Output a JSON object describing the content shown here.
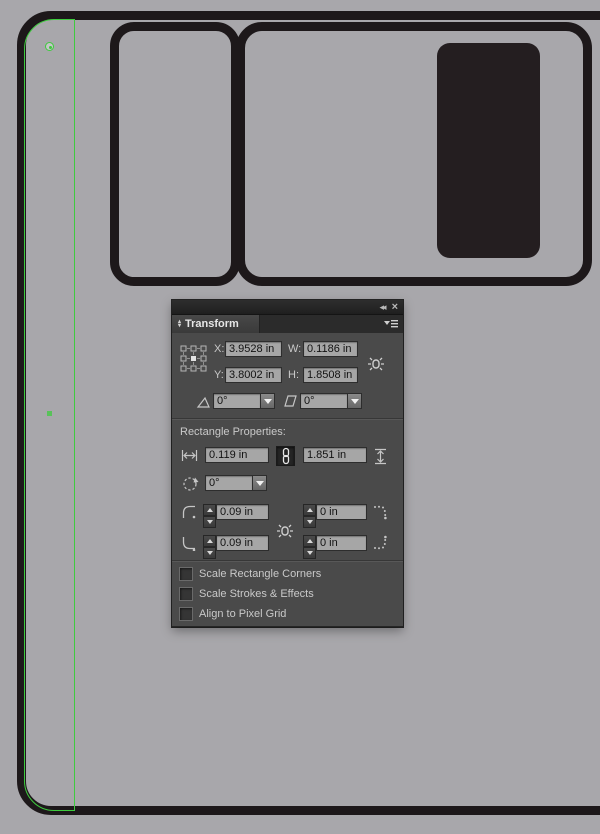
{
  "panel": {
    "tab_title": "Transform",
    "window_icons": {
      "collapse": "◂◂",
      "close": "×"
    },
    "fields": {
      "x_label": "X:",
      "x_value": "3.9528 in",
      "y_label": "Y:",
      "y_value": "3.8002 in",
      "w_label": "W:",
      "w_value": "0.1186 in",
      "h_label": "H:",
      "h_value": "1.8508 in",
      "rotate_value": "0°",
      "shear_value": "0°"
    },
    "rectangle_properties": {
      "heading": "Rectangle Properties:",
      "width_value": "0.119 in",
      "height_value": "1.851 in",
      "angle_value": "0°",
      "corner_top_left": "0.09 in",
      "corner_top_right": "0 in",
      "corner_bottom_left": "0.09 in",
      "corner_bottom_right": "0 in"
    },
    "checkboxes": [
      {
        "label": "Scale Rectangle Corners",
        "checked": false
      },
      {
        "label": "Scale Strokes & Effects",
        "checked": false
      },
      {
        "label": "Align to Pixel Grid",
        "checked": false
      }
    ]
  },
  "canvas": {
    "background_color": "#a8a7ab",
    "stroke_color": "#1d181a",
    "window_fill_color": "#241e20",
    "selection_color": "#3ecb3e"
  }
}
